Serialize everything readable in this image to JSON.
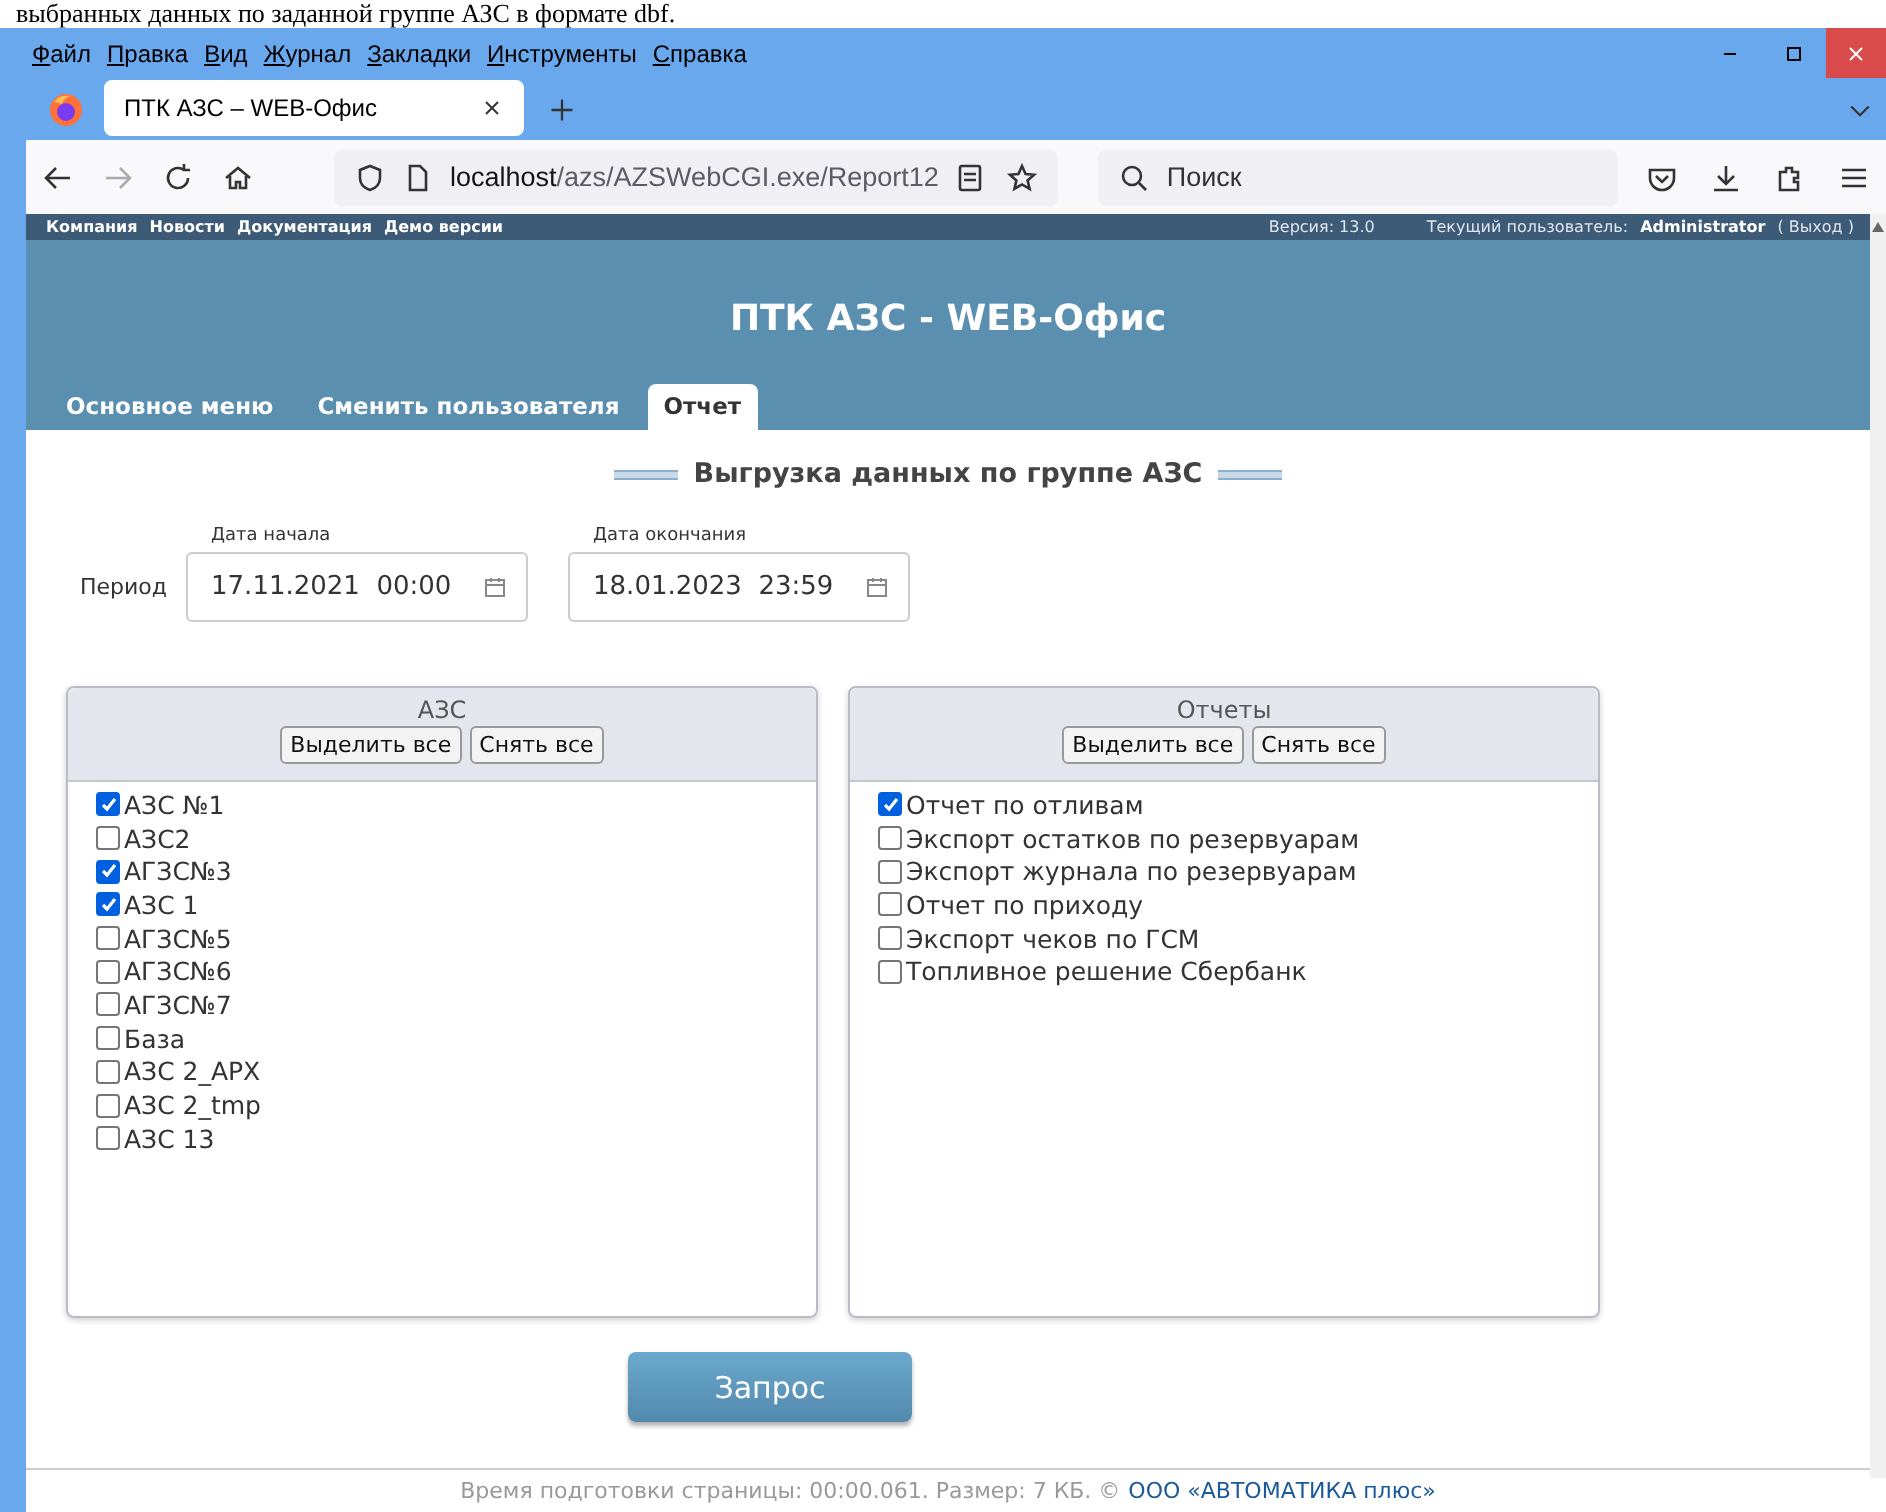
{
  "document_caption": "выбранных данных по заданной группе АЗС в формате dbf.",
  "browser": {
    "menu": [
      "Файл",
      "Правка",
      "Вид",
      "Журнал",
      "Закладки",
      "Инструменты",
      "Справка"
    ],
    "tab_title": "ПТК АЗС – WEB-Офис",
    "url_host": "localhost",
    "url_path": "/azs/AZSWebCGI.exe/Report12",
    "search_placeholder": "Поиск"
  },
  "topbar": {
    "links": [
      "Компания",
      "Новости",
      "Документация",
      "Демо версии"
    ],
    "version": "Версия: 13.0",
    "user_label": "Текущий пользователь:",
    "user": "Administrator",
    "logout": "( Выход )"
  },
  "header": {
    "title": "ПТК АЗС - WEB-Офис"
  },
  "nav_tabs": [
    {
      "label": "Основное меню",
      "selected": false
    },
    {
      "label": "Сменить пользователя",
      "selected": false
    },
    {
      "label": "Отчет",
      "selected": true
    }
  ],
  "report": {
    "title": "Выгрузка данных по группе АЗС",
    "period_label": "Период",
    "start": {
      "label": "Дата начала",
      "value": "17.11.2021  00:00"
    },
    "end": {
      "label": "Дата окончания",
      "value": "18.01.2023  23:59"
    }
  },
  "panels": [
    {
      "title": "АЗС",
      "buttons": [
        "Выделить все",
        "Снять все"
      ],
      "items": [
        {
          "label": "АЗС №1",
          "checked": true
        },
        {
          "label": "АЗС2",
          "checked": false
        },
        {
          "label": "АГЗС№3",
          "checked": true
        },
        {
          "label": "АЗС 1",
          "checked": true
        },
        {
          "label": "АГЗС№5",
          "checked": false
        },
        {
          "label": "АГЗС№6",
          "checked": false
        },
        {
          "label": "АГЗС№7",
          "checked": false
        },
        {
          "label": "База",
          "checked": false
        },
        {
          "label": "АЗС 2_АРХ",
          "checked": false
        },
        {
          "label": "АЗС 2_tmp",
          "checked": false
        },
        {
          "label": "АЗС 13",
          "checked": false
        }
      ]
    },
    {
      "title": "Отчеты",
      "buttons": [
        "Выделить все",
        "Снять все"
      ],
      "items": [
        {
          "label": "Отчет по отливам",
          "checked": true
        },
        {
          "label": "Экспорт остатков по резервуарам",
          "checked": false
        },
        {
          "label": "Экспорт журнала по резервуарам",
          "checked": false
        },
        {
          "label": "Отчет по приходу",
          "checked": false
        },
        {
          "label": "Экспорт чеков по ГСМ",
          "checked": false
        },
        {
          "label": "Топливное решение Сбербанк",
          "checked": false
        }
      ]
    }
  ],
  "submit_button": "Запрос",
  "footer": {
    "text": "Время подготовки страницы: 00:00.061. Размер: 7 КБ. ©",
    "link": "ООО «АВТОМАТИКА плюс»"
  }
}
